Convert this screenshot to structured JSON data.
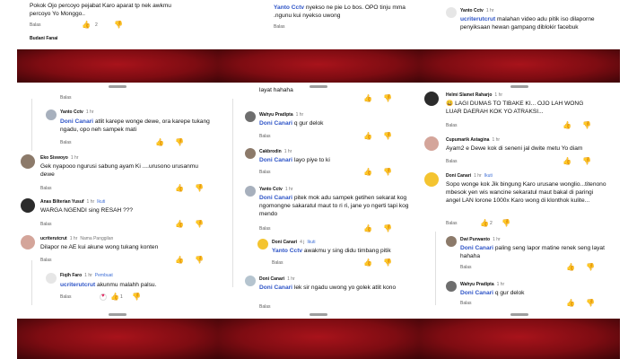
{
  "actions": {
    "reply": "Balas"
  },
  "col1": {
    "top_text_1": "Pokok Ojo percoyo pejabat Karo aparat tp nek awkmu",
    "top_text_2": "percoyo Yo Monggo..",
    "top_likes": "2",
    "partial_name": "Budani Fanai",
    "c1": {
      "name": "Yanto Cctv",
      "time": "1 hr",
      "mention": "Doni Canari",
      "text": "atlit karepe wonge dewe, ora karepe tukang ngadu, opo neh sampek mati"
    },
    "c2": {
      "name": "Eko Siswoyo",
      "time": "1 hr",
      "text": "Gek nyapooo ngurusi sabung ayam Ki ....urusono urusanmu dewe"
    },
    "c3": {
      "name": "Anas Bilterian Yusuf",
      "time": "1 hr",
      "tag": "Ikuti",
      "text": "WARGA NGENDI sing RESAH ???"
    },
    "c4": {
      "name": "ucriterutcrut",
      "time": "1 hr",
      "tag": "Nama Panggilan",
      "text": "Dilapor ne AE kui akune wong tukang konten"
    },
    "c5": {
      "name": "Fiqih Faro",
      "time": "1 hr",
      "tag": "Pembuat",
      "mention": "ucriterutcrut",
      "text": "akunmu malahh palsu.",
      "likes": "1"
    }
  },
  "col2": {
    "top": {
      "mention": "Yanto Cctv",
      "text": "nyekso ne pie Lo bos. OPO tinju mma .ngunu kui nyekso uwong"
    },
    "c0": {
      "text": "layat hahaha"
    },
    "c1": {
      "name": "Wahyu Pradipta",
      "time": "1 hr",
      "mention": "Doni Canari",
      "text": "q gur delok"
    },
    "c2": {
      "name": "Cakbrodin",
      "time": "1 hr",
      "mention": "Doni Canari",
      "text": "layo piye to ki"
    },
    "c3": {
      "name": "Yanto Cctv",
      "time": "1 hr",
      "mention": "Doni Canari",
      "text": "pitek mok adu sampek getihen sekarat kog ngomongne sakaratul maut to ri ri, jane yo ngerti tapi kog mendo"
    },
    "c4": {
      "name": "Doni Canari",
      "time": "4 j",
      "tag": "Ikuti",
      "mention": "Yanto Cctv",
      "text": "awakmu y sing didu timbang pitik"
    },
    "c5": {
      "name": "Doni Canari",
      "time": "1 hr",
      "mention": "Doni Canari",
      "text": "lek sir ngadu uwong yo golek atlit kono"
    }
  },
  "col3": {
    "top": {
      "name": "Yanto Cctv",
      "time": "1 hr",
      "mention": "ucriterutcrut",
      "text": "malahan video adu pitik iso dilaporne penyiksaan hewan gampang diblokir facebuk"
    },
    "c1": {
      "name": "Helmi Slamet Raharjo",
      "time": "1 hr",
      "text": "LAGI DUMAS TO TIBAKE KI... OJO LAH WONG LUAR DAERAH KOK YO ATRAKSI..."
    },
    "c2": {
      "name": "Cupumarik Astagina",
      "time": "1 hr",
      "text": "Ayam2 e Dewe kok di seneni jal dwite metu Yo diam"
    },
    "c3": {
      "name": "Doni Canari",
      "time": "1 hr",
      "tag": "Ikuti",
      "text": "Sopo wonge kok Jik bingung Karo urusane wonglio...titenono mbesok yen wis wancine sekaratul maut bakal di paringi angel LAN lorone 1000x Karo wong di klonthok kulite...",
      "likes": "2"
    },
    "c4": {
      "name": "Dwi Purwanto",
      "time": "1 hr",
      "mention": "Doni Canari",
      "text": "paling seng lapor matine renek seng layat hahaha"
    },
    "c5": {
      "name": "Wahyu Pradipta",
      "time": "1 hr",
      "mention": "Doni Canari",
      "text": "q gur delok"
    }
  }
}
